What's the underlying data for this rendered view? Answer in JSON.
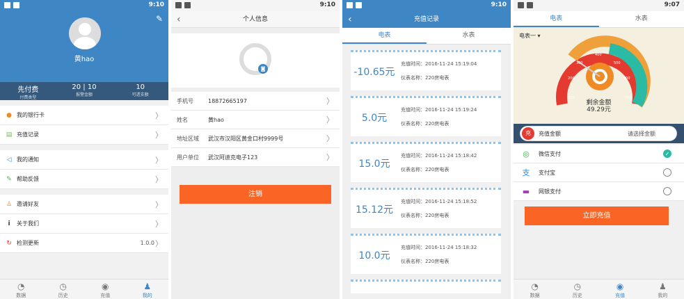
{
  "status": {
    "time1": "9:10",
    "time2": "9:10",
    "time3": "9:10",
    "time4": "9:07"
  },
  "s1": {
    "name": "黄hao",
    "stats": [
      {
        "v": "先付费",
        "l": "付费类型"
      },
      {
        "v": "20 | 10",
        "l": "报警金额"
      },
      {
        "v": "10",
        "l": "可透支额"
      }
    ],
    "menu": [
      {
        "label": "我的银行卡",
        "icon": "●",
        "color": "#f08a24"
      },
      {
        "label": "充值记录",
        "icon": "▤",
        "color": "#6cbf5a"
      },
      {
        "label": "我的通知",
        "icon": "◁",
        "color": "#3f86c4"
      },
      {
        "label": "帮助反馈",
        "icon": "✎",
        "color": "#4caf50"
      },
      {
        "label": "邀请好友",
        "icon": "♙",
        "color": "#f08a24"
      },
      {
        "label": "关于我们",
        "icon": "i",
        "color": "#333"
      },
      {
        "label": "检测更新",
        "icon": "↻",
        "color": "#e53a2f"
      }
    ],
    "version": "1.0.0"
  },
  "tabs": {
    "t1": "数据",
    "t2": "历史",
    "t3": "充值",
    "t4": "我的"
  },
  "s2": {
    "title": "个人信息",
    "fields": [
      {
        "k": "手机号",
        "v": "18872665197"
      },
      {
        "k": "姓名",
        "v": "黄hao"
      },
      {
        "k": "地址区域",
        "v": "武汉市汉阳区黄金口村9999号"
      },
      {
        "k": "用户单位",
        "v": "武汉阿迪克电子123"
      }
    ],
    "logout": "注销"
  },
  "s3": {
    "title": "充值记录",
    "tab1": "电表",
    "tab2": "水表",
    "records": [
      {
        "amt": "-10.65元",
        "time": "充值时间：2016-11-24 15:19:04",
        "meter": "仪表名称：220房电表"
      },
      {
        "amt": "5.0元",
        "time": "充值时间：2016-11-24 15:19:24",
        "meter": "仪表名称：220房电表"
      },
      {
        "amt": "15.0元",
        "time": "充值时间：2016-11-24 15:18:42",
        "meter": "仪表名称：220房电表"
      },
      {
        "amt": "15.12元",
        "time": "充值时间：2016-11-24 15:18:52",
        "meter": "仪表名称：220房电表"
      },
      {
        "amt": "10.0元",
        "time": "充值时间：2016-11-24 15:18:32",
        "meter": "仪表名称：220房电表"
      }
    ]
  },
  "s4": {
    "tab1": "电表",
    "tab2": "水表",
    "meter": "电表一",
    "label": "剩余金额",
    "value": "49.29元",
    "ticks": [
      "100",
      "200",
      "300",
      "400",
      "500",
      "600",
      "700"
    ],
    "amount_label": "充值金额",
    "amount_sel": "请选择金额",
    "pay": [
      {
        "label": "微信支付",
        "icon": "◎",
        "color": "#2bbb34"
      },
      {
        "label": "支付宝",
        "icon": "支",
        "color": "#1f8fe0"
      },
      {
        "label": "网银支付",
        "icon": "▬",
        "color": "#a040b8"
      }
    ],
    "submit": "立即充值"
  }
}
